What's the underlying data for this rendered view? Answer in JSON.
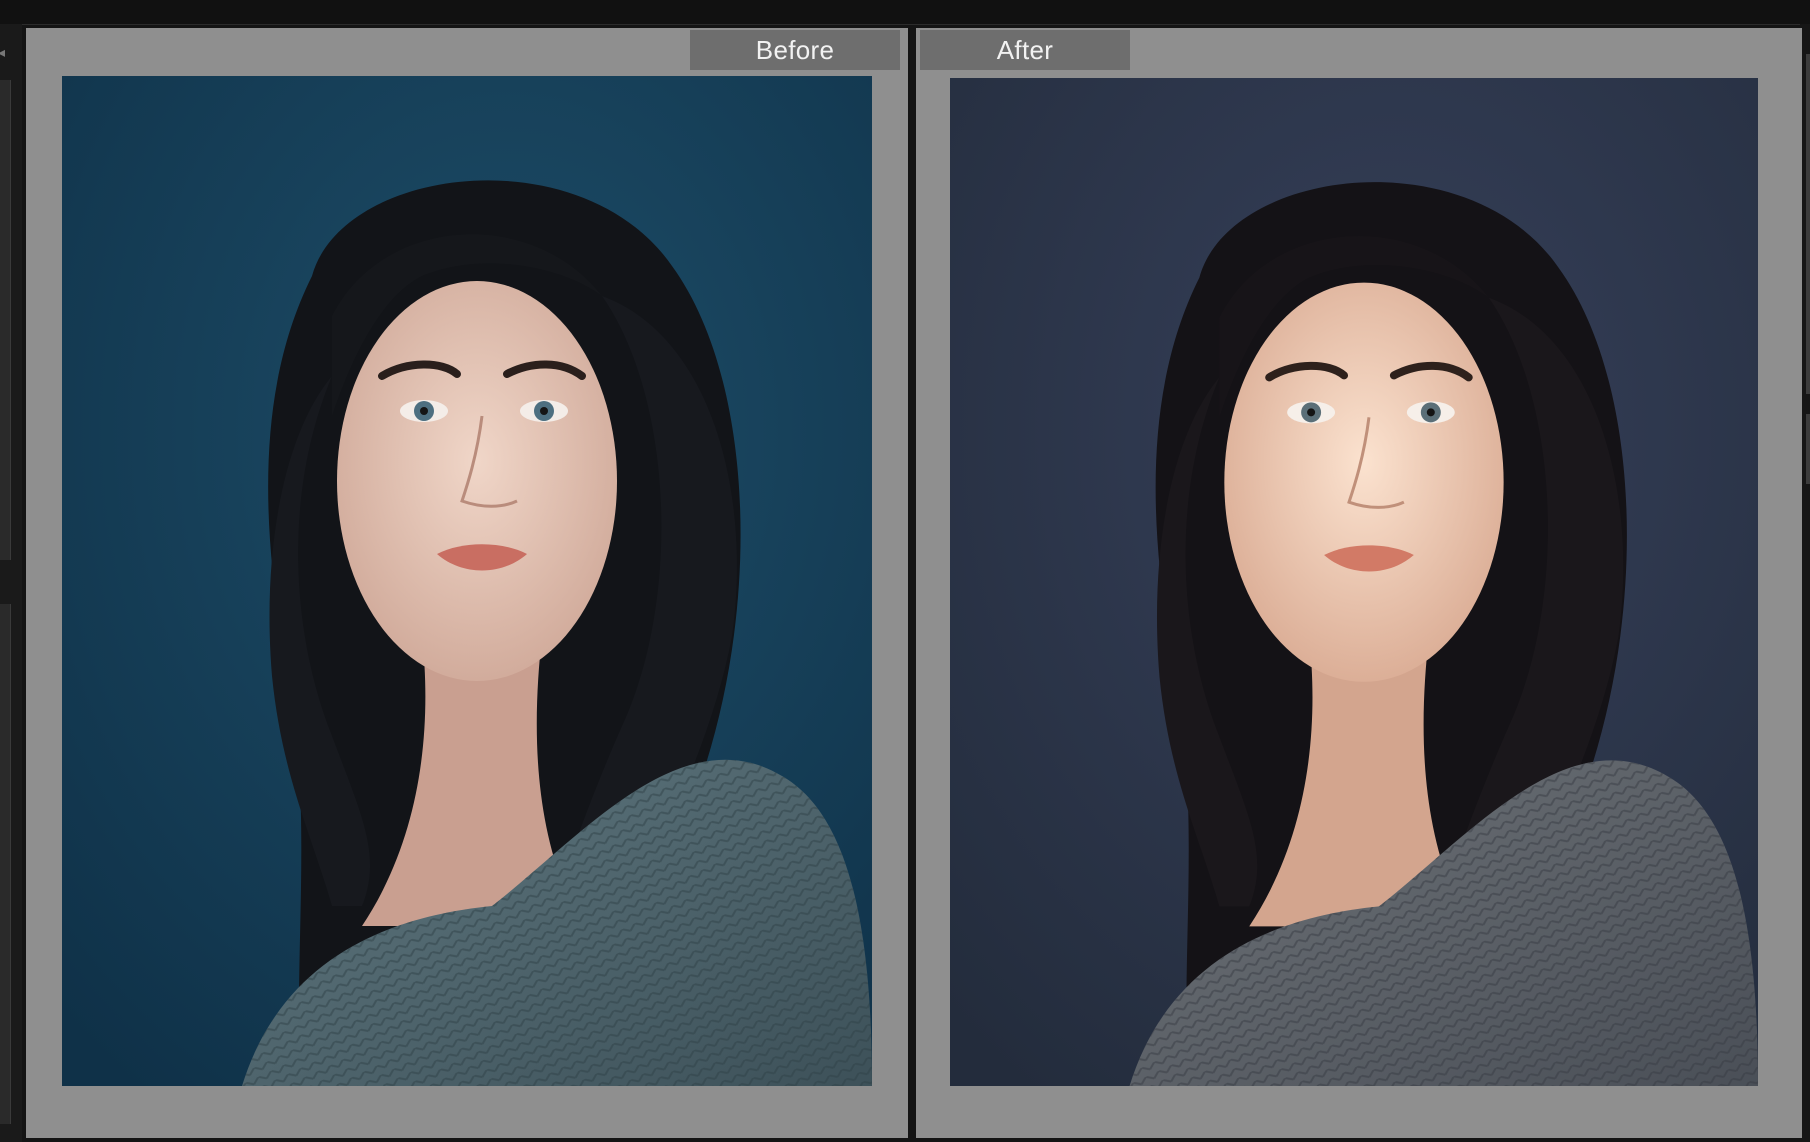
{
  "compare_view": {
    "before_label": "Before",
    "after_label": "After"
  },
  "colors": {
    "pane_background": "#8f8f8f",
    "label_background": "#6e6e6e",
    "before_backdrop": "#143a52",
    "after_backdrop": "#2a3446"
  }
}
